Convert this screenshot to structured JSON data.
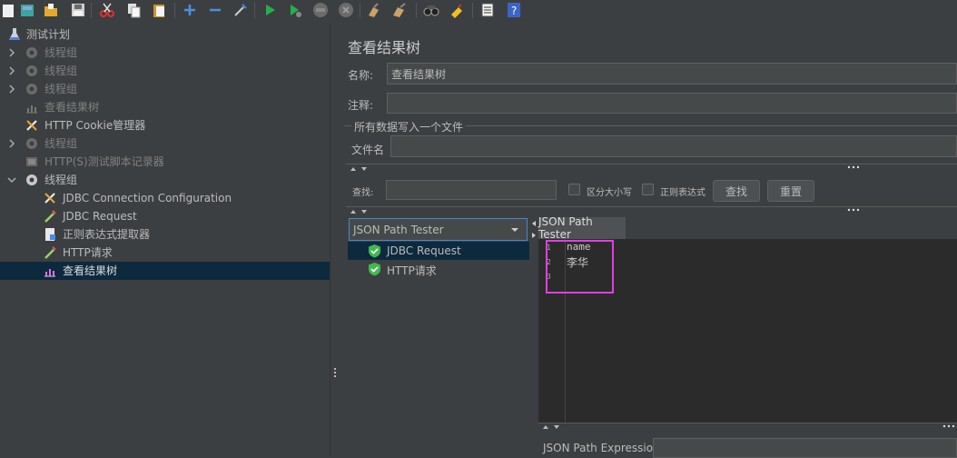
{
  "toolbar": {
    "icons": [
      "template-icon",
      "open-icon",
      "open-folder-icon",
      "save-icon",
      "cut-icon",
      "copy-icon",
      "paste-icon",
      "expand-icon",
      "collapse-icon",
      "toggle-icon",
      "start-icon",
      "start-no-pause-icon",
      "stop-icon",
      "shutdown-icon",
      "clear-icon",
      "clear-all-icon",
      "search-icon",
      "reset-search-icon",
      "function-helper-icon",
      "help-icon"
    ]
  },
  "tree": {
    "items": [
      {
        "label": "测试计划"
      },
      {
        "label": "线程组"
      },
      {
        "label": "线程组"
      },
      {
        "label": "线程组"
      },
      {
        "label": "查看结果树"
      },
      {
        "label": "HTTP Cookie管理器"
      },
      {
        "label": "线程组"
      },
      {
        "label": "HTTP(S)测试脚本记录器"
      },
      {
        "label": "线程组"
      },
      {
        "label": "JDBC Connection Configuration"
      },
      {
        "label": "JDBC Request"
      },
      {
        "label": "正则表达式提取器"
      },
      {
        "label": "HTTP请求"
      },
      {
        "label": "查看结果树"
      }
    ]
  },
  "panel": {
    "title": "查看结果树",
    "name_label": "名称:",
    "name_value": "查看结果树",
    "comment_label": "注释:",
    "comment_value": "",
    "file_group": "所有数据写入一个文件",
    "filename_label": "文件名",
    "filename_value": ""
  },
  "search": {
    "label": "查找:",
    "value": "",
    "case_label": "区分大小写",
    "regex_label": "正则表达式",
    "find_button": "查找",
    "reset_button": "重置"
  },
  "results": {
    "renderer": "JSON Path Tester",
    "samples": [
      "JDBC Request",
      "HTTP请求"
    ]
  },
  "tester": {
    "tab": "JSON Path Tester",
    "line_numbers": [
      "1",
      "2",
      "3"
    ],
    "lines": [
      "name",
      "李华",
      ""
    ],
    "expression_label": "JSON Path Expression"
  },
  "colors": {
    "background": "#3c3f41",
    "selection": "#0d293e",
    "editor": "#2b2b2b",
    "highlight": "#e040e0",
    "check_green": "#3fb950"
  }
}
